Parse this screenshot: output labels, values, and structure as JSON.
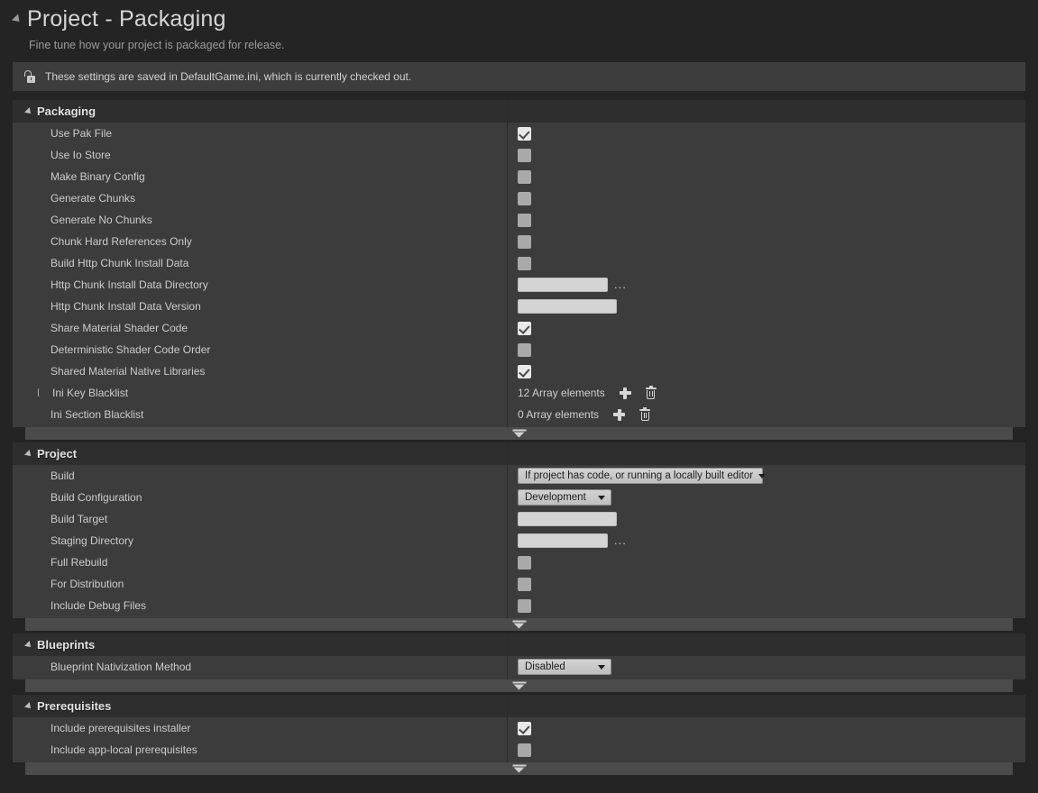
{
  "header": {
    "title": "Project - Packaging",
    "subtitle": "Fine tune how your project is packaged for release.",
    "expander_icon": "triangle-down-icon"
  },
  "notice": {
    "icon": "unlocked-padlock-icon",
    "text": "These settings are saved in DefaultGame.ini, which is currently checked out."
  },
  "sections": [
    {
      "title": "Packaging",
      "rows": [
        {
          "label": "Use Pak File",
          "type": "checkbox",
          "checked": true
        },
        {
          "label": "Use Io Store",
          "type": "checkbox",
          "checked": false
        },
        {
          "label": "Make Binary Config",
          "type": "checkbox",
          "checked": false
        },
        {
          "label": "Generate Chunks",
          "type": "checkbox",
          "checked": false
        },
        {
          "label": "Generate No Chunks",
          "type": "checkbox",
          "checked": false
        },
        {
          "label": "Chunk Hard References Only",
          "type": "checkbox",
          "checked": false
        },
        {
          "label": "Build Http Chunk Install Data",
          "type": "checkbox",
          "checked": false
        },
        {
          "label": "Http Chunk Install Data Directory",
          "type": "path",
          "value": "",
          "browse_label": "..."
        },
        {
          "label": "Http Chunk Install Data Version",
          "type": "text",
          "value": ""
        },
        {
          "label": "Share Material Shader Code",
          "type": "checkbox",
          "checked": true
        },
        {
          "label": "Deterministic Shader Code Order",
          "type": "checkbox",
          "checked": false
        },
        {
          "label": "Shared Material Native Libraries",
          "type": "checkbox",
          "checked": true
        },
        {
          "label": "Ini Key Blacklist",
          "type": "array",
          "value": "12 Array elements",
          "expandable": true
        },
        {
          "label": "Ini Section Blacklist",
          "type": "array",
          "value": "0 Array elements",
          "expandable": false
        }
      ]
    },
    {
      "title": "Project",
      "rows": [
        {
          "label": "Build",
          "type": "dropdown",
          "value": "If project has code, or running a locally built editor",
          "width": "wide"
        },
        {
          "label": "Build Configuration",
          "type": "dropdown",
          "value": "Development",
          "width": "med"
        },
        {
          "label": "Build Target",
          "type": "text",
          "value": ""
        },
        {
          "label": "Staging Directory",
          "type": "path",
          "value": "",
          "browse_label": "..."
        },
        {
          "label": "Full Rebuild",
          "type": "checkbox",
          "checked": false
        },
        {
          "label": "For Distribution",
          "type": "checkbox",
          "checked": false
        },
        {
          "label": "Include Debug Files",
          "type": "checkbox",
          "checked": false
        }
      ]
    },
    {
      "title": "Blueprints",
      "rows": [
        {
          "label": "Blueprint Nativization Method",
          "type": "dropdown",
          "value": "Disabled",
          "width": "med"
        }
      ]
    },
    {
      "title": "Prerequisites",
      "rows": [
        {
          "label": "Include prerequisites installer",
          "type": "checkbox",
          "checked": true
        },
        {
          "label": "Include app-local prerequisites",
          "type": "checkbox",
          "checked": false
        }
      ]
    }
  ],
  "splitter": {
    "icon": "caret-down-handle-icon"
  },
  "colors": {
    "window_bg": "#242424",
    "section_bg": "#3c3c3c",
    "section_header_bg": "#2e2e2e",
    "notice_bg": "#3d3d3d",
    "splitter_bg": "#4b4b4b",
    "label_text": "#cccccc",
    "title_text": "#d6d6d6",
    "checkbox_on": "#e9e9e9",
    "checkbox_off": "#a9a9a9",
    "input_bg": "#d4d4d4",
    "dropdown_bg": "#c9c9c9"
  }
}
